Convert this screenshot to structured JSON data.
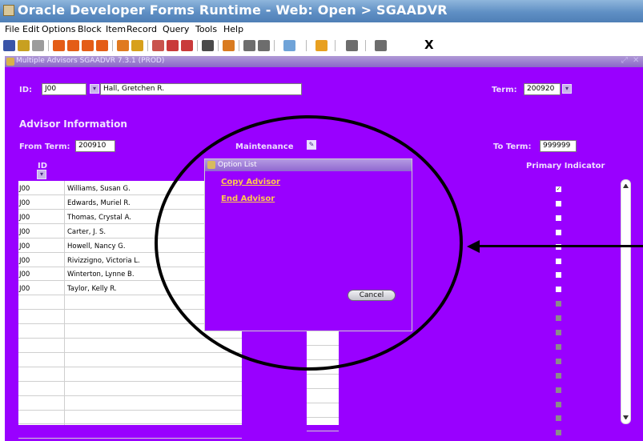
{
  "window": {
    "title": "Oracle Developer Forms Runtime - Web:  Open > SGAADVR"
  },
  "menu": [
    "File",
    "Edit",
    "Options",
    "Block",
    "Item",
    "Record",
    "Query",
    "Tools",
    "Help"
  ],
  "toolbar": {
    "icons": [
      {
        "name": "save-icon",
        "color": "#3a54a8"
      },
      {
        "name": "undo-icon",
        "color": "#c8a020"
      },
      {
        "name": "print-icon",
        "color": "#9c9c9c"
      },
      {
        "name": "first-record-icon",
        "color": "#e45d17"
      },
      {
        "name": "previous-record-icon",
        "color": "#e45d17"
      },
      {
        "name": "next-record-icon",
        "color": "#e45d17"
      },
      {
        "name": "last-record-icon",
        "color": "#e45d17"
      },
      {
        "name": "enter-query-icon",
        "color": "#e07a20"
      },
      {
        "name": "execute-query-icon",
        "color": "#d7a01b"
      },
      {
        "name": "insert-record-icon",
        "color": "#c9534d"
      },
      {
        "name": "remove-record-icon",
        "color": "#c93a3a"
      },
      {
        "name": "clear-record-icon",
        "color": "#c93a3a"
      },
      {
        "name": "list-of-values-icon",
        "color": "#4a4a4a"
      },
      {
        "name": "attachment-icon",
        "color": "#d97b20"
      },
      {
        "name": "edit-field-icon",
        "color": "#6d6d6d"
      },
      {
        "name": "spell-check-icon",
        "color": "#6d6d6d"
      },
      {
        "name": "back-icon",
        "color": "#6fa3d8"
      },
      {
        "name": "help-icon",
        "color": "#e8a020"
      },
      {
        "name": "info-icon",
        "color": "#6d6d6d"
      },
      {
        "name": "online-help-icon",
        "color": "#6d6d6d"
      }
    ],
    "exit_label": "X"
  },
  "form_window": {
    "title": "Multiple Advisors  SGAADVR  7.3.1  (PROD)"
  },
  "key_block": {
    "id_label": "ID:",
    "id_value": "J00",
    "name_value": "Hall, Gretchen R.",
    "term_label": "Term:",
    "term_value": "200920"
  },
  "advisor_block": {
    "header": "Advisor Information",
    "from_term_label": "From Term:",
    "from_term_value": "200910",
    "maintenance_label": "Maintenance",
    "to_term_label": "To Term:",
    "to_term_value": "999999",
    "id_col_label": "ID",
    "primary_indicator_label": "Primary Indicator",
    "rows": [
      {
        "id": "J00",
        "name": "Williams, Susan G.",
        "primary": "check"
      },
      {
        "id": "J00",
        "name": "Edwards, Muriel R.",
        "primary": "on"
      },
      {
        "id": "J00",
        "name": "Thomas, Crystal A.",
        "primary": "on"
      },
      {
        "id": "J00",
        "name": "Carter, J. S.",
        "primary": "on"
      },
      {
        "id": "J00",
        "name": "Howell, Nancy G.",
        "primary": "on"
      },
      {
        "id": "J00",
        "name": "Rivizzigno, Victoria L.",
        "primary": "on"
      },
      {
        "id": "J00",
        "name": "Winterton, Lynne B.",
        "primary": "on"
      },
      {
        "id": "J00",
        "name": "Taylor, Kelly R.",
        "primary": "on"
      },
      {
        "id": "",
        "name": "",
        "primary": "off"
      },
      {
        "id": "",
        "name": "",
        "primary": "off"
      },
      {
        "id": "",
        "name": "",
        "primary": "off"
      },
      {
        "id": "",
        "name": "",
        "primary": "off"
      },
      {
        "id": "",
        "name": "",
        "primary": "off"
      },
      {
        "id": "",
        "name": "",
        "primary": "off"
      },
      {
        "id": "",
        "name": "",
        "primary": "off"
      },
      {
        "id": "",
        "name": "",
        "primary": "off"
      },
      {
        "id": "",
        "name": "",
        "primary": "off"
      },
      {
        "id": "",
        "name": "",
        "primary": "off"
      }
    ]
  },
  "dialog": {
    "title": "Option List",
    "options": [
      "Copy Advisor",
      "End Advisor"
    ],
    "cancel_label": "Cancel"
  },
  "colors": {
    "canvas": "#9900ff",
    "title_bar": "#5f8fc4",
    "option_link": "#ffc94d"
  }
}
